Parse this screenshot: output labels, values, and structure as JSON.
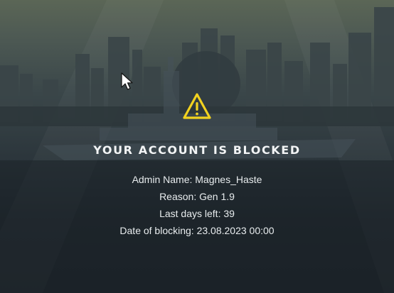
{
  "colors": {
    "accent_warning": "#f2d21f",
    "text_primary": "#f2f4f5",
    "background_dark": "#1b2228"
  },
  "icons": {
    "warning": "warning-triangle-icon",
    "cursor": "mouse-pointer-icon"
  },
  "blocked_panel": {
    "title": "YOUR ACCOUNT IS BLOCKED",
    "admin_name": "Admin Name: Magnes_Haste",
    "reason": "Reason: Gen 1.9",
    "days_left": "Last days left: 39",
    "date_of_blocking": "Date of blocking: 23.08.2023 00:00"
  }
}
